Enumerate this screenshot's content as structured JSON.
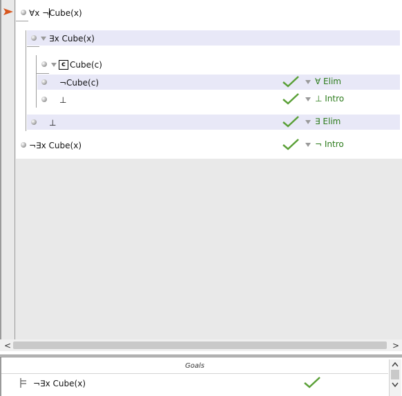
{
  "proof": {
    "premise": "∀x ¬Cube(x)",
    "subproof1_assumption": "∃x Cube(x)",
    "subproof2_box_label": "c",
    "subproof2_assumption": "Cube(c)",
    "line_neg_cube_c": "¬Cube(c)",
    "line_bottom_inner": "⊥",
    "line_bottom_outer": "⊥",
    "conclusion": "¬∃x Cube(x)",
    "rules": {
      "neg_cube_c": "∀ Elim",
      "bottom_inner": "⊥ Intro",
      "bottom_outer": "∃ Elim",
      "conclusion": "¬ Intro"
    }
  },
  "goals": {
    "header": "Goals",
    "goal1": "¬∃x Cube(x)"
  },
  "scrollbar": {
    "left_arrow": "<",
    "right_arrow": ">"
  },
  "colors": {
    "rule_text": "#2a7a19",
    "check": "#5aa037",
    "band": "#e8e8f7",
    "focus_arrow": "#d8561d"
  }
}
